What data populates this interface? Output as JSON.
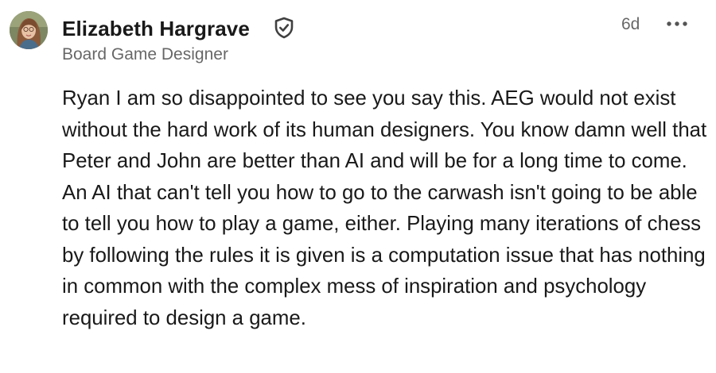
{
  "comment": {
    "author": {
      "name": "Elizabeth Hargrave",
      "headline": "Board Game Designer",
      "verified_icon": "shield-check-icon",
      "avatar_icon": "profile-photo"
    },
    "timestamp": "6d",
    "more_icon": "ellipsis-icon",
    "body": "Ryan I am so disappointed to see you say this. AEG would not exist without the hard work of its human designers. You know damn well that Peter and John are better than AI and will be for a long time to come. An AI that can't tell you how to go to the carwash isn't going to be able to tell you how to play a game, either. Playing many iterations of chess by following the rules it is given is a computation issue that has nothing in common with the complex mess of inspiration and psychology required to design a game."
  },
  "colors": {
    "text_primary": "#1a1a1a",
    "text_secondary": "#666666",
    "background": "#ffffff"
  }
}
